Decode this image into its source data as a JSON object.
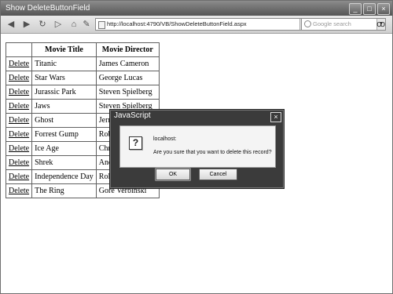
{
  "window": {
    "title": "Show DeleteButtonField",
    "controls": {
      "minimize": "_",
      "maximize": "□",
      "close": "×"
    }
  },
  "toolbar": {
    "url": "http://localhost:4790/VB/ShowDeleteButtonField.aspx",
    "search_placeholder": "Google search",
    "nav_icons": [
      "back-icon",
      "forward-icon",
      "reload-icon",
      "stop-icon",
      "home-icon",
      "edit-icon"
    ]
  },
  "table": {
    "headers": [
      "",
      "Movie Title",
      "Movie Director"
    ],
    "rows": [
      {
        "action": "Delete",
        "title": "Titanic",
        "director": "James Cameron"
      },
      {
        "action": "Delete",
        "title": "Star Wars",
        "director": "George Lucas"
      },
      {
        "action": "Delete",
        "title": "Jurassic Park",
        "director": "Steven Spielberg"
      },
      {
        "action": "Delete",
        "title": "Jaws",
        "director": "Steven Spielberg"
      },
      {
        "action": "Delete",
        "title": "Ghost",
        "director": "Jerry Zucker"
      },
      {
        "action": "Delete",
        "title": "Forrest Gump",
        "director": "Robert Zemeckis"
      },
      {
        "action": "Delete",
        "title": "Ice Age",
        "director": "Chris Wedge"
      },
      {
        "action": "Delete",
        "title": "Shrek",
        "director": "Andrew Adamson"
      },
      {
        "action": "Delete",
        "title": "Independence Day",
        "director": "Roland Emmerich"
      },
      {
        "action": "Delete",
        "title": "The Ring",
        "director": "Gore Verbinski"
      }
    ]
  },
  "dialog": {
    "title": "JavaScript",
    "host": "localhost:",
    "message": "Are you sure that you want to delete this record?",
    "ok_label": "OK",
    "cancel_label": "Cancel",
    "close": "×",
    "icon": "question-icon"
  }
}
